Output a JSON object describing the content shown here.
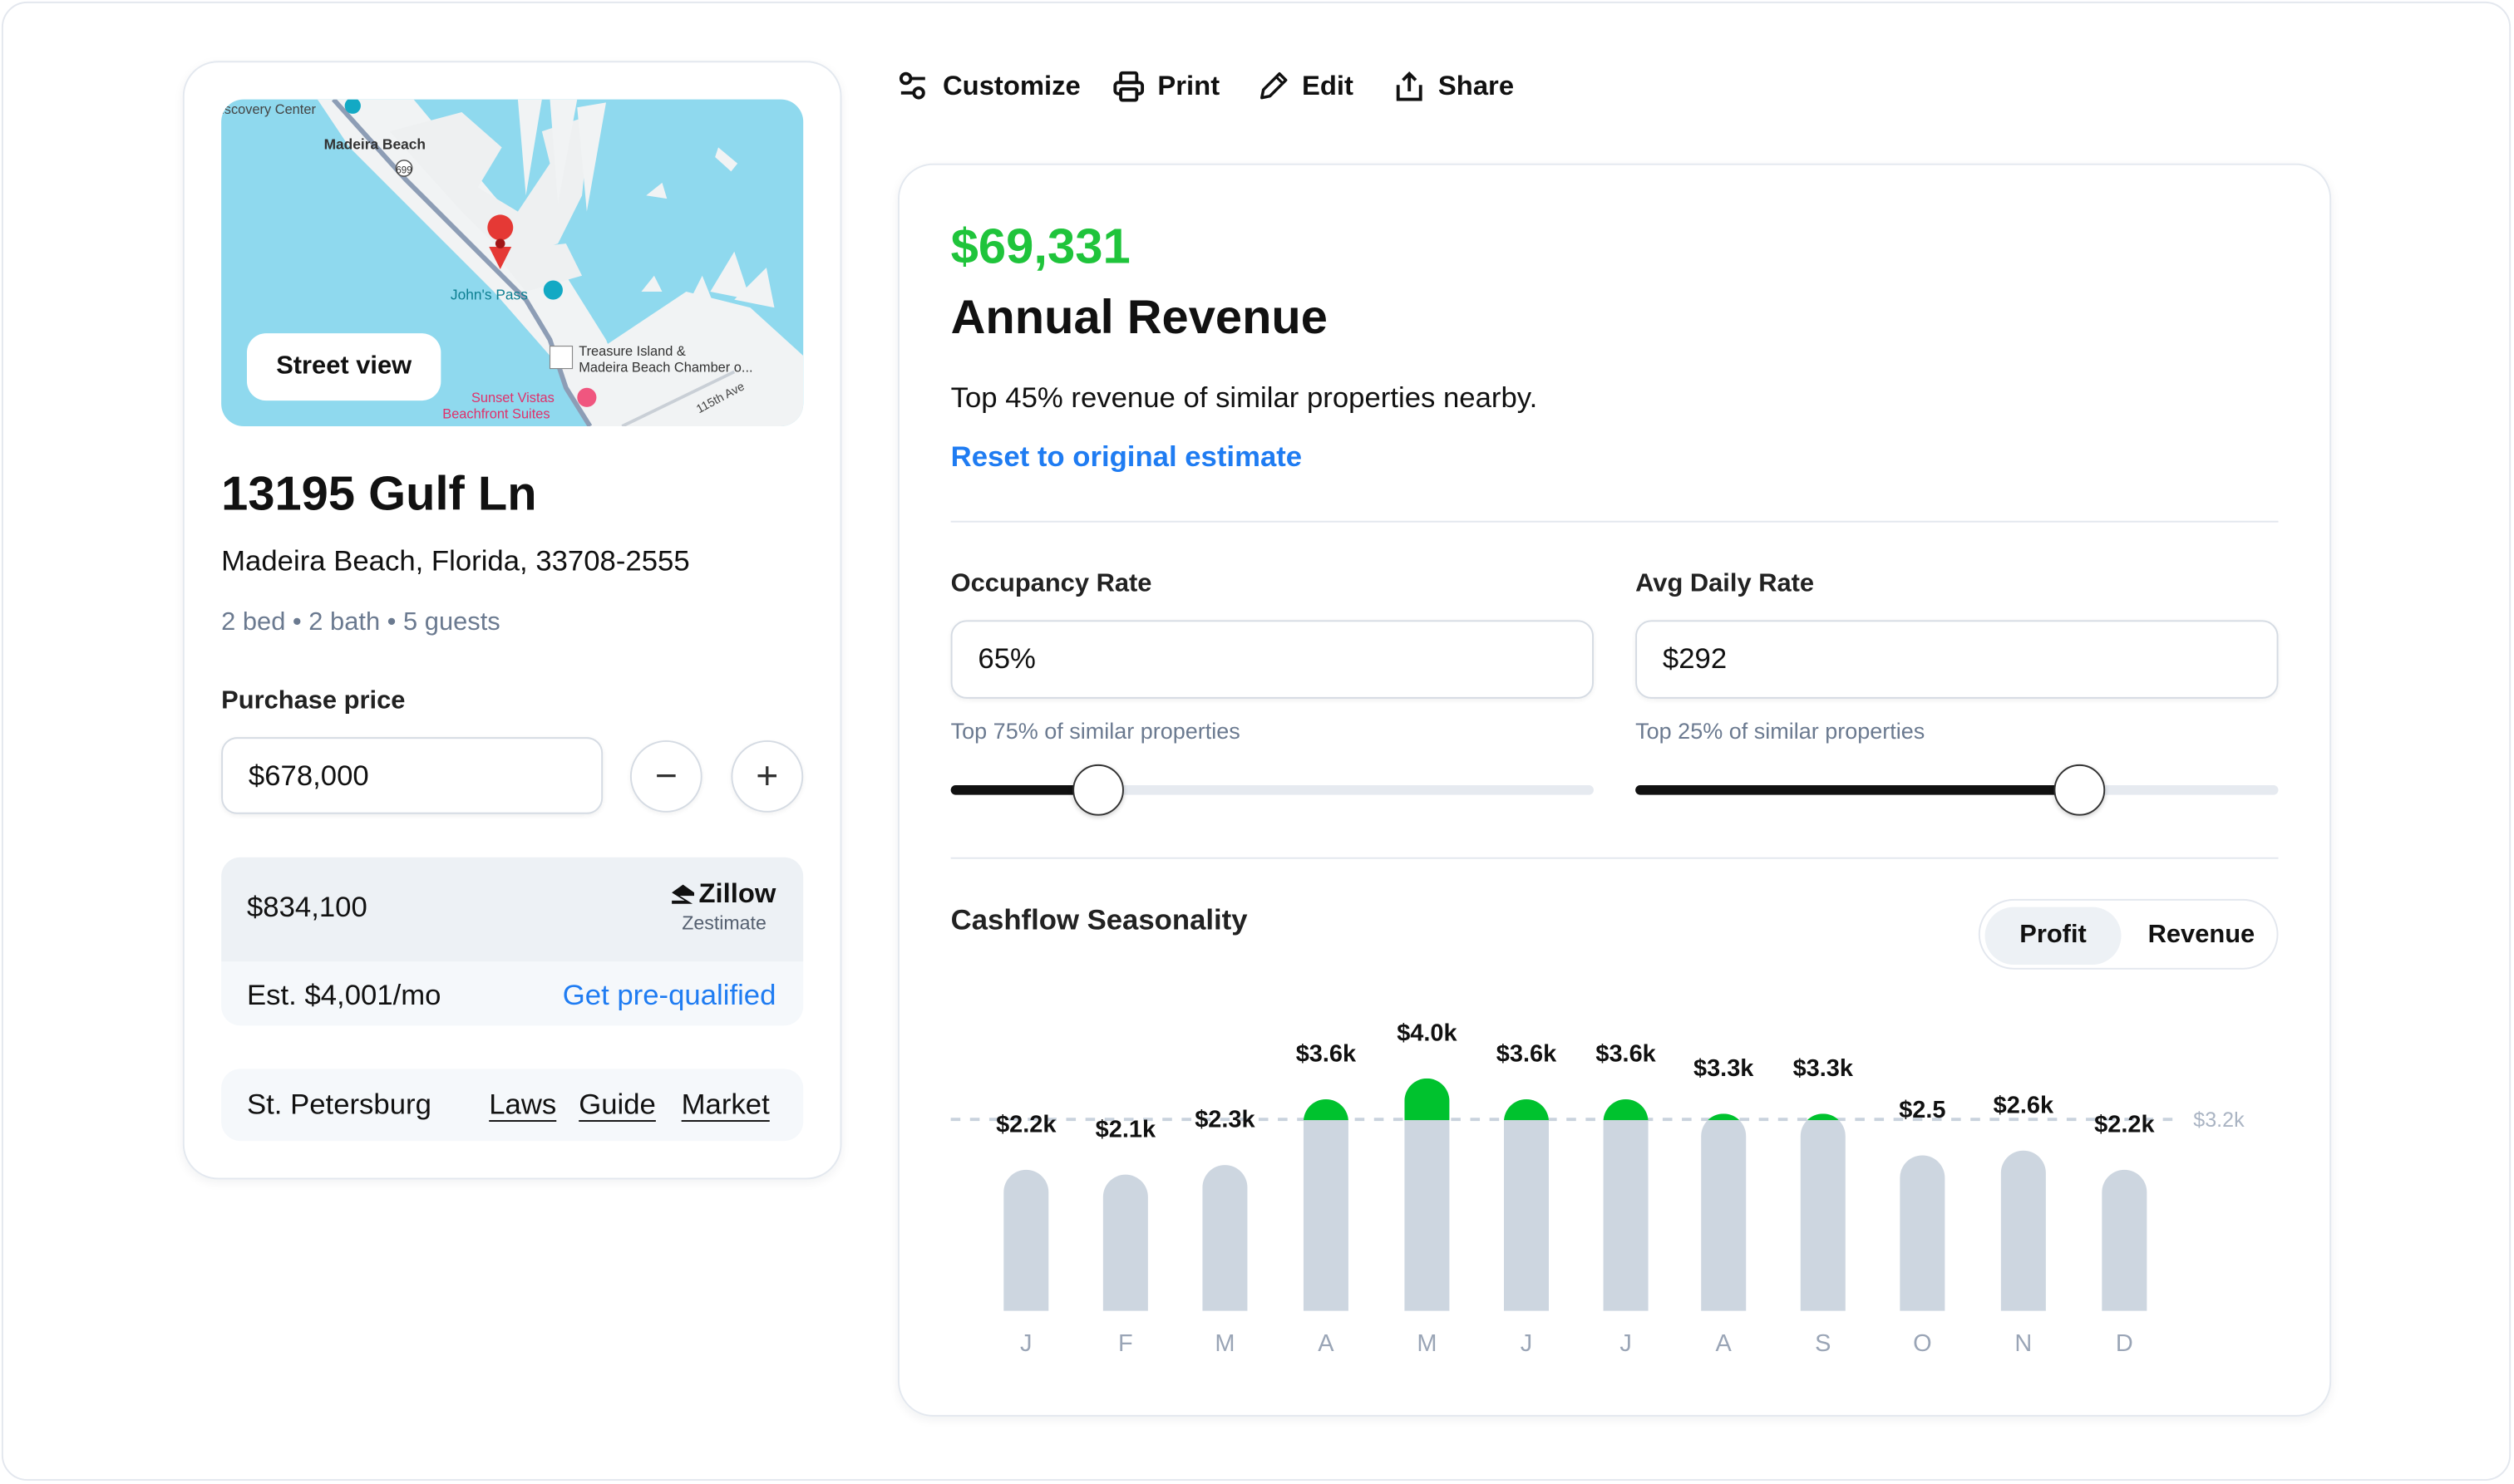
{
  "map": {
    "street_view_label": "Street view",
    "labels": {
      "discovery": "iscovery Center",
      "madeira": "Madeira Beach",
      "route": "699",
      "johns_pass": "John's Pass",
      "chamber_1": "Treasure Island &",
      "chamber_2": "Madeira Beach Chamber o...",
      "sunset_1": "Sunset Vistas",
      "sunset_2": "Beachfront Suites",
      "street": "115th Ave"
    }
  },
  "property": {
    "title": "13195 Gulf Ln",
    "address": "Madeira Beach, Florida, 33708-2555",
    "meta": "2 bed • 2 bath • 5 guests",
    "purchase_label": "Purchase price",
    "purchase_value": "$678,000",
    "minus": "−",
    "plus": "+"
  },
  "zillow": {
    "estimate": "$834,100",
    "brand": "Zillow",
    "sub": "Zestimate",
    "monthly": "Est. $4,001/mo",
    "prequal": "Get pre-qualified"
  },
  "city": {
    "name": "St. Petersburg",
    "links": [
      "Laws",
      "Guide",
      "Market"
    ]
  },
  "toolbar": {
    "customize": "Customize",
    "print": "Print",
    "edit": "Edit",
    "share": "Share"
  },
  "revenue": {
    "amount": "$69,331",
    "title": "Annual Revenue",
    "subtitle": "Top 45% revenue of similar properties nearby.",
    "reset": "Reset to original estimate",
    "occupancy": {
      "label": "Occupancy Rate",
      "value": "65%",
      "helper": "Top 75% of similar properties",
      "slider_fraction": 0.23
    },
    "adr": {
      "label": "Avg Daily Rate",
      "value": "$292",
      "helper": "Top 25% of similar properties",
      "slider_fraction": 0.69
    }
  },
  "seasonality": {
    "title": "Cashflow Seasonality",
    "toggle": {
      "options": [
        "Profit",
        "Revenue"
      ],
      "selected": "Profit"
    }
  },
  "colors": {
    "accent_green": "#1fc43b",
    "bar_green": "#00c22e",
    "bar_gray": "#cdd6e0",
    "link_blue": "#1f7cf2"
  },
  "chart_data": {
    "type": "bar",
    "categories": [
      "J",
      "F",
      "M",
      "A",
      "M",
      "J",
      "J",
      "A",
      "S",
      "O",
      "N",
      "D"
    ],
    "values": [
      2.2,
      2.1,
      2.3,
      3.6,
      4.0,
      3.6,
      3.6,
      3.3,
      3.3,
      2.5,
      2.6,
      2.2
    ],
    "data_labels": [
      "$2.2k",
      "$2.1k",
      "$2.3k",
      "$3.6k",
      "$4.0k",
      "$3.6k",
      "$3.6k",
      "$3.3k",
      "$3.3k",
      "$2.5",
      "$2.6k",
      "$2.2k"
    ],
    "unit": "$k",
    "reference_line": {
      "value": 3.2,
      "label": "$3.2k",
      "style": "dashed"
    },
    "above_reference_color": "#00c22e",
    "grid": false,
    "legend": "none"
  }
}
